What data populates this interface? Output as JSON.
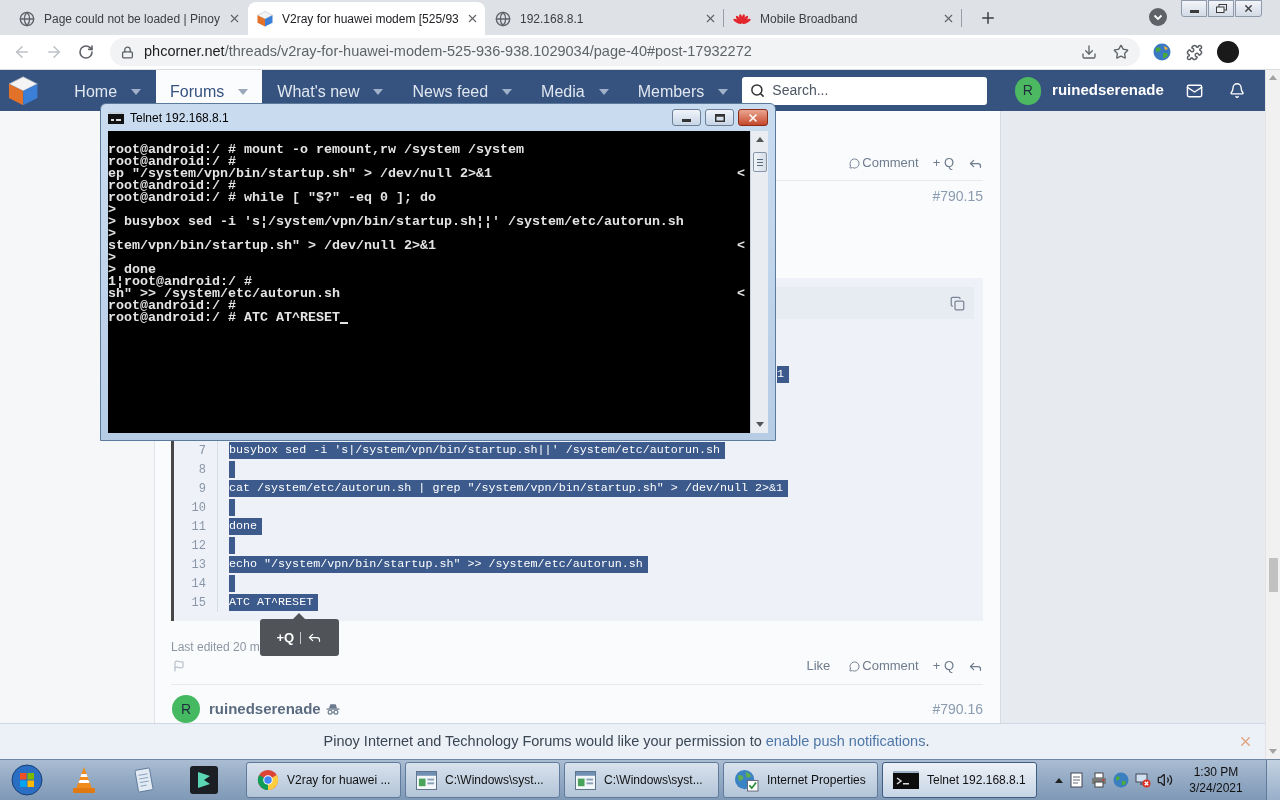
{
  "browser": {
    "tabs": [
      {
        "title": "Page could not be loaded | Pinoy",
        "kind": "page",
        "selected": false
      },
      {
        "title": "V2ray for huawei modem [525/93",
        "kind": "forum",
        "selected": true
      },
      {
        "title": "192.168.8.1",
        "kind": "page",
        "selected": false
      },
      {
        "title": "Mobile Broadband",
        "kind": "vendor",
        "selected": false
      }
    ],
    "back": {
      "disabled": true
    },
    "forward": {
      "disabled": true
    },
    "address": {
      "host": "phcorner.net",
      "path": "/threads/v2ray-for-huawei-modem-525-936-938.1029034/page-40#post-17932272"
    }
  },
  "site_nav": {
    "items": [
      {
        "label": "Home",
        "selected": false,
        "menu": true
      },
      {
        "label": "Forums",
        "selected": true,
        "menu": true
      },
      {
        "label": "What's new",
        "selected": false,
        "menu": true
      },
      {
        "label": "News feed",
        "selected": false,
        "menu": true
      },
      {
        "label": "Media",
        "selected": false,
        "menu": true
      },
      {
        "label": "Members",
        "selected": false,
        "menu": true
      }
    ],
    "search": {
      "placeholder": "Search..."
    },
    "user": {
      "initial": "R",
      "name": "ruinedserenade"
    }
  },
  "previous_post": {
    "comment": "Comment",
    "quote": "+ Q"
  },
  "post": {
    "number": "#790.15",
    "code": {
      "covered_fragment": "1",
      "lines": [
        {
          "number": "7",
          "text": "busybox sed -i 's|/system/vpn/bin/startup.sh||' /system/etc/autorun.sh",
          "selected": true
        },
        {
          "number": "8",
          "selected": true
        },
        {
          "number": "9",
          "text": "cat /system/etc/autorun.sh | grep \"/system/vpn/bin/startup.sh\" > /dev/null 2>&1",
          "selected": true
        },
        {
          "number": "10",
          "selected": true
        },
        {
          "number": "11",
          "text": "done",
          "selected": true
        },
        {
          "number": "12",
          "selected": true
        },
        {
          "number": "13",
          "text": "echo \"/system/vpn/bin/startup.sh\" >> /system/etc/autorun.sh",
          "selected": true
        },
        {
          "number": "14",
          "selected": true
        },
        {
          "number": "15",
          "text": "ATC AT^RESET",
          "selected": true
        }
      ]
    },
    "edited": "Last edited 20 m",
    "tooltip": {
      "quote": "+Q"
    },
    "like": "Like",
    "comment": "Comment",
    "quote": "+ Q"
  },
  "next_post": {
    "initial": "R",
    "author": "ruinedserenade",
    "number": "#790.16"
  },
  "notification": {
    "text": "Pinoy Internet and Technology Forums would like your permission to",
    "link": "enable push notifications",
    "end": "."
  },
  "telnet": {
    "title": "Telnet 192.168.8.1",
    "lines": [
      {
        "text": "root@android:/ # mount -o remount,rw /system /system",
        "cursor": false
      },
      {
        "text": "root@android:/ #",
        "cursor": false
      },
      {
        "text": "ep \"/system/vpn/bin/startup.sh\" > /dev/null 2>&1",
        "marker": "<",
        "cursor": false
      },
      {
        "text": "root@android:/ #",
        "cursor": false
      },
      {
        "text": "root@android:/ # while [ \"$?\" -eq 0 ]; do",
        "cursor": false
      },
      {
        "text": ">",
        "cursor": false
      },
      {
        "text": "> busybox sed -i 's¦/system/vpn/bin/startup.sh¦¦' /system/etc/autorun.sh",
        "cursor": false
      },
      {
        "text": ">",
        "cursor": false
      },
      {
        "text": "stem/vpn/bin/startup.sh\" > /dev/null 2>&1",
        "marker": "<",
        "cursor": false
      },
      {
        "text": ">",
        "cursor": false
      },
      {
        "text": "> done",
        "cursor": false
      },
      {
        "text": "1¦root@android:/ #",
        "cursor": false
      },
      {
        "text": "sh\" >> /system/etc/autorun.sh",
        "marker": "<",
        "cursor": false
      },
      {
        "text": "root@android:/ #",
        "cursor": false
      },
      {
        "text": "root@android:/ # ATC AT^RESET",
        "cursor": true
      }
    ]
  },
  "taskbar": {
    "buttons": [
      {
        "label": "V2ray for huawei ...",
        "kind": "browser",
        "active": false
      },
      {
        "label": "C:\\Windows\\syst...",
        "kind": "console",
        "active": false
      },
      {
        "label": "C:\\Windows\\syst...",
        "kind": "console",
        "active": false
      },
      {
        "label": "Internet Properties",
        "kind": "settings",
        "active": false
      },
      {
        "label": "Telnet 192.168.8.1",
        "kind": "terminal",
        "active": true
      }
    ],
    "clock": {
      "time": "1:30 PM",
      "date": "3/24/2021"
    }
  }
}
